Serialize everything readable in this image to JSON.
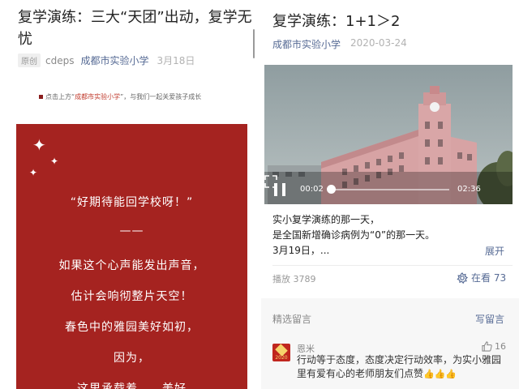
{
  "left": {
    "title": "复学演练：三大“天团”出动，复学无忧",
    "original_tag": "原创",
    "author": "cdeps",
    "account": "成都市实验小学",
    "date": "3月18日",
    "follow_prefix": "点击上方“",
    "follow_account": "成都市实验小学",
    "follow_suffix": "”，与我们一起关爱孩子成长",
    "poem": [
      "“好期待能回学校呀！”",
      "——",
      "如果这个心声能发出声音，",
      "估计会响彻整片天空！",
      "春色中的雅园美好如初，",
      "因为，",
      "这里承载着……美好"
    ]
  },
  "right": {
    "title": "复学演练：1+1＞2",
    "account": "成都市实验小学",
    "date": "2020-03-24",
    "video": {
      "current_time": "00:02",
      "total_time": "02:36",
      "progress": 0.013
    },
    "description": [
      "实小复学演练的那一天，",
      "是全国新增确诊病例为“0”的那一天。",
      "3月19日，..."
    ],
    "expand_label": "展开",
    "plays": "播放 3789",
    "likes": "在看 73",
    "comments_header": "精选留言",
    "write_comment": "写留言",
    "comment": {
      "name": "恩米",
      "likes": "16",
      "text": "行动等于态度，态度决定行动效率，为实小雅园里有爱有心的老师朋友们点赞",
      "avatar_text": "2020"
    }
  },
  "colors": {
    "accent_blue": "#576b95",
    "poster_red": "#a52320"
  }
}
